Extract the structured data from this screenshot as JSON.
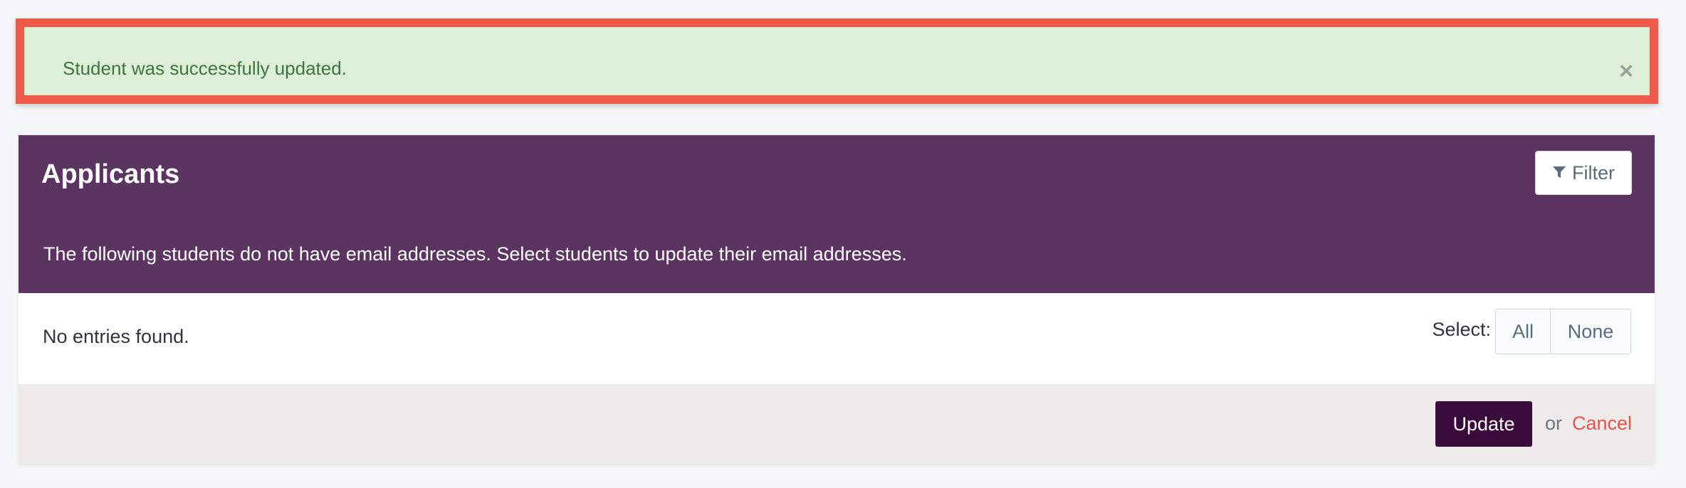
{
  "alert": {
    "message": "Student was successfully updated.",
    "close_icon": "close-icon",
    "close_glyph": "×"
  },
  "panel": {
    "title": "Applicants",
    "filter": {
      "label": "Filter",
      "icon": "filter-icon"
    },
    "description": "The following students do not have email addresses. Select students to update their email addresses.",
    "empty_text": "No entries found.",
    "select": {
      "label": "Select:",
      "all": "All",
      "none": "None"
    },
    "footer": {
      "update_label": "Update",
      "or_text": "or",
      "cancel_label": "Cancel"
    }
  },
  "colors": {
    "header_bg": "#5c3461",
    "alert_bg": "#dff0d8",
    "alert_text": "#3c763d",
    "highlight_outline": "#f05a4b",
    "update_bg": "#3b0a3c",
    "cancel_text": "#e5534b",
    "footer_bg": "#efebea"
  }
}
